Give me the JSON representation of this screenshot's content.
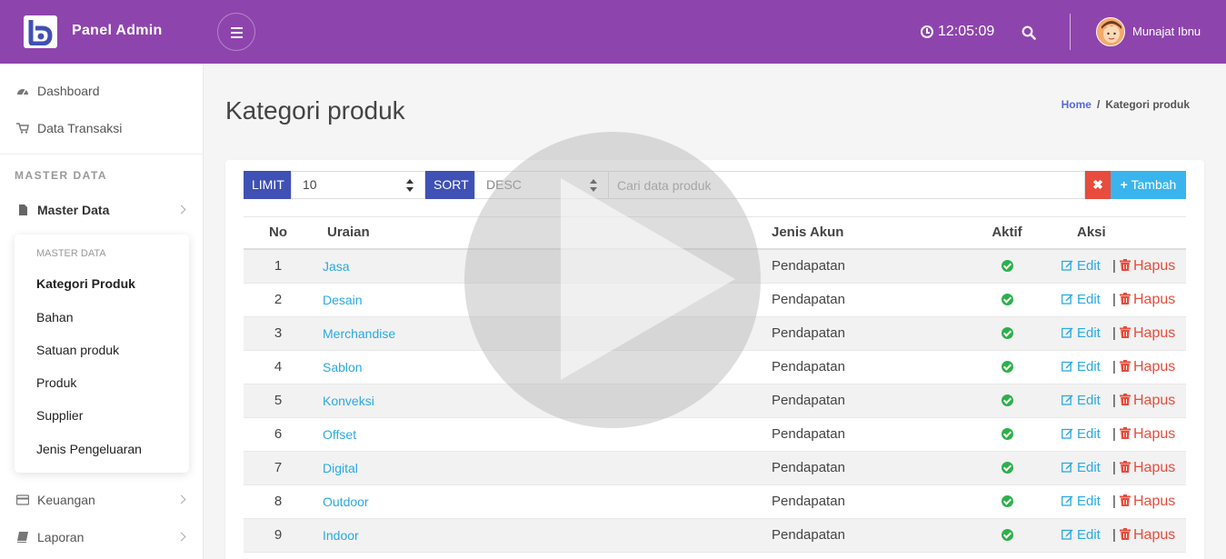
{
  "header": {
    "brand": "Panel Admin",
    "clock": "12:05:09",
    "username": "Munajat Ibnu"
  },
  "sidebar": {
    "dashboard": "Dashboard",
    "transaksi": "Data Transaksi",
    "section_header": "MASTER DATA",
    "master_data": "Master Data",
    "submenu": {
      "header": "MASTER DATA",
      "items": [
        "Kategori Produk",
        "Bahan",
        "Satuan produk",
        "Produk",
        "Supplier",
        "Jenis Pengeluaran"
      ]
    },
    "keuangan": "Keuangan",
    "laporan": "Laporan"
  },
  "page": {
    "title": "Kategori produk",
    "breadcrumb_home": "Home",
    "breadcrumb_sep": "/",
    "breadcrumb_current": "Kategori produk"
  },
  "filter": {
    "limit_label": "LIMIT",
    "limit_value": "10",
    "sort_label": "SORT",
    "sort_value": "DESC",
    "search_placeholder": "Cari data produk",
    "clear_label": "✖",
    "add_label": "Tambah"
  },
  "table": {
    "headers": {
      "no": "No",
      "uraian": "Uraian",
      "jenis": "Jenis Akun",
      "aktif": "Aktif",
      "aksi": "Aksi"
    },
    "edit_label": "Edit",
    "delete_label": "Hapus",
    "separator": "|",
    "rows": [
      {
        "no": "1",
        "uraian": "Jasa",
        "jenis": "Pendapatan"
      },
      {
        "no": "2",
        "uraian": "Desain",
        "jenis": "Pendapatan"
      },
      {
        "no": "3",
        "uraian": "Merchandise",
        "jenis": "Pendapatan"
      },
      {
        "no": "4",
        "uraian": "Sablon",
        "jenis": "Pendapatan"
      },
      {
        "no": "5",
        "uraian": "Konveksi",
        "jenis": "Pendapatan"
      },
      {
        "no": "6",
        "uraian": "Offset",
        "jenis": "Pendapatan"
      },
      {
        "no": "7",
        "uraian": "Digital",
        "jenis": "Pendapatan"
      },
      {
        "no": "8",
        "uraian": "Outdoor",
        "jenis": "Pendapatan"
      },
      {
        "no": "9",
        "uraian": "Indoor",
        "jenis": "Pendapatan"
      }
    ]
  },
  "colors": {
    "topbar": "#8e44ad",
    "label_bg": "#3f51b5",
    "link": "#29aae1",
    "danger": "#e74c3c",
    "success": "#2db04b"
  }
}
